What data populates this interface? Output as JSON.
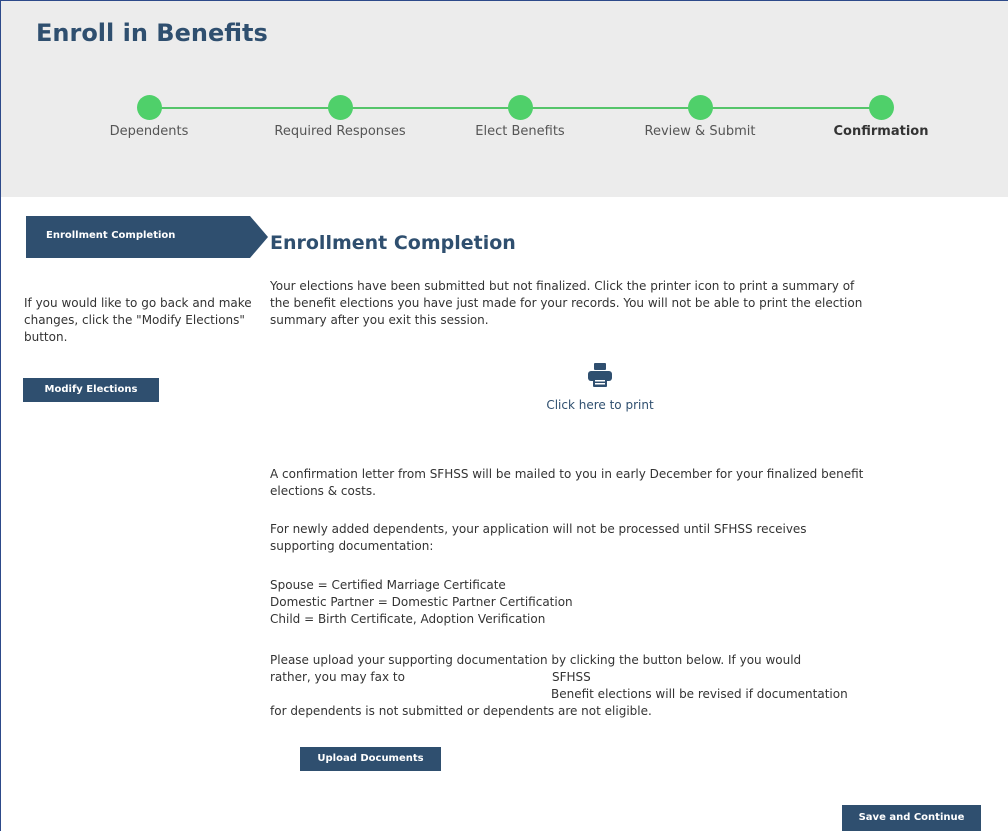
{
  "header": {
    "title": "Enroll in Benefits"
  },
  "steps": [
    {
      "label": "Dependents",
      "current": false
    },
    {
      "label": "Required Responses",
      "current": false
    },
    {
      "label": "Elect Benefits",
      "current": false
    },
    {
      "label": "Review & Submit",
      "current": false
    },
    {
      "label": "Confirmation",
      "current": true
    }
  ],
  "sidebar": {
    "tab_label": "Enrollment Completion",
    "help_text": "If you would like to go back and make changes, click the \"Modify Elections\" button.",
    "modify_button": "Modify Elections"
  },
  "main": {
    "title": "Enrollment Completion",
    "intro": "Your elections have been submitted but not finalized. Click the printer icon to print a summary of the benefit elections you have just made for your records. You will not be able to print the election summary after you exit this session.",
    "print_label": "Click here to print",
    "print_icon": "printer-icon",
    "confirmation_letter": "A confirmation letter from SFHSS will be mailed to you in early December for your finalized benefit elections & costs.",
    "dependents_note": "For newly added dependents, your application will not be processed until SFHSS receives supporting documentation:",
    "documents": [
      "Spouse = Certified Marriage Certificate",
      "Domestic Partner = Domestic Partner Certification",
      "Child = Birth Certificate, Adoption Verification"
    ],
    "upload_line1": "Please upload your supporting documentation by clicking the button below. If you would",
    "upload_line2a": "rather, you may fax to",
    "upload_line2b": "SFHSS",
    "upload_line3": "Benefit elections will be revised if documentation",
    "upload_line4": "for dependents is not submitted or dependents are not eligible.",
    "upload_button": "Upload Documents",
    "save_button": "Save and Continue"
  },
  "colors": {
    "primary": "#2f4f6f",
    "step_dot": "#4fd06a",
    "header_bg": "#ececec"
  }
}
